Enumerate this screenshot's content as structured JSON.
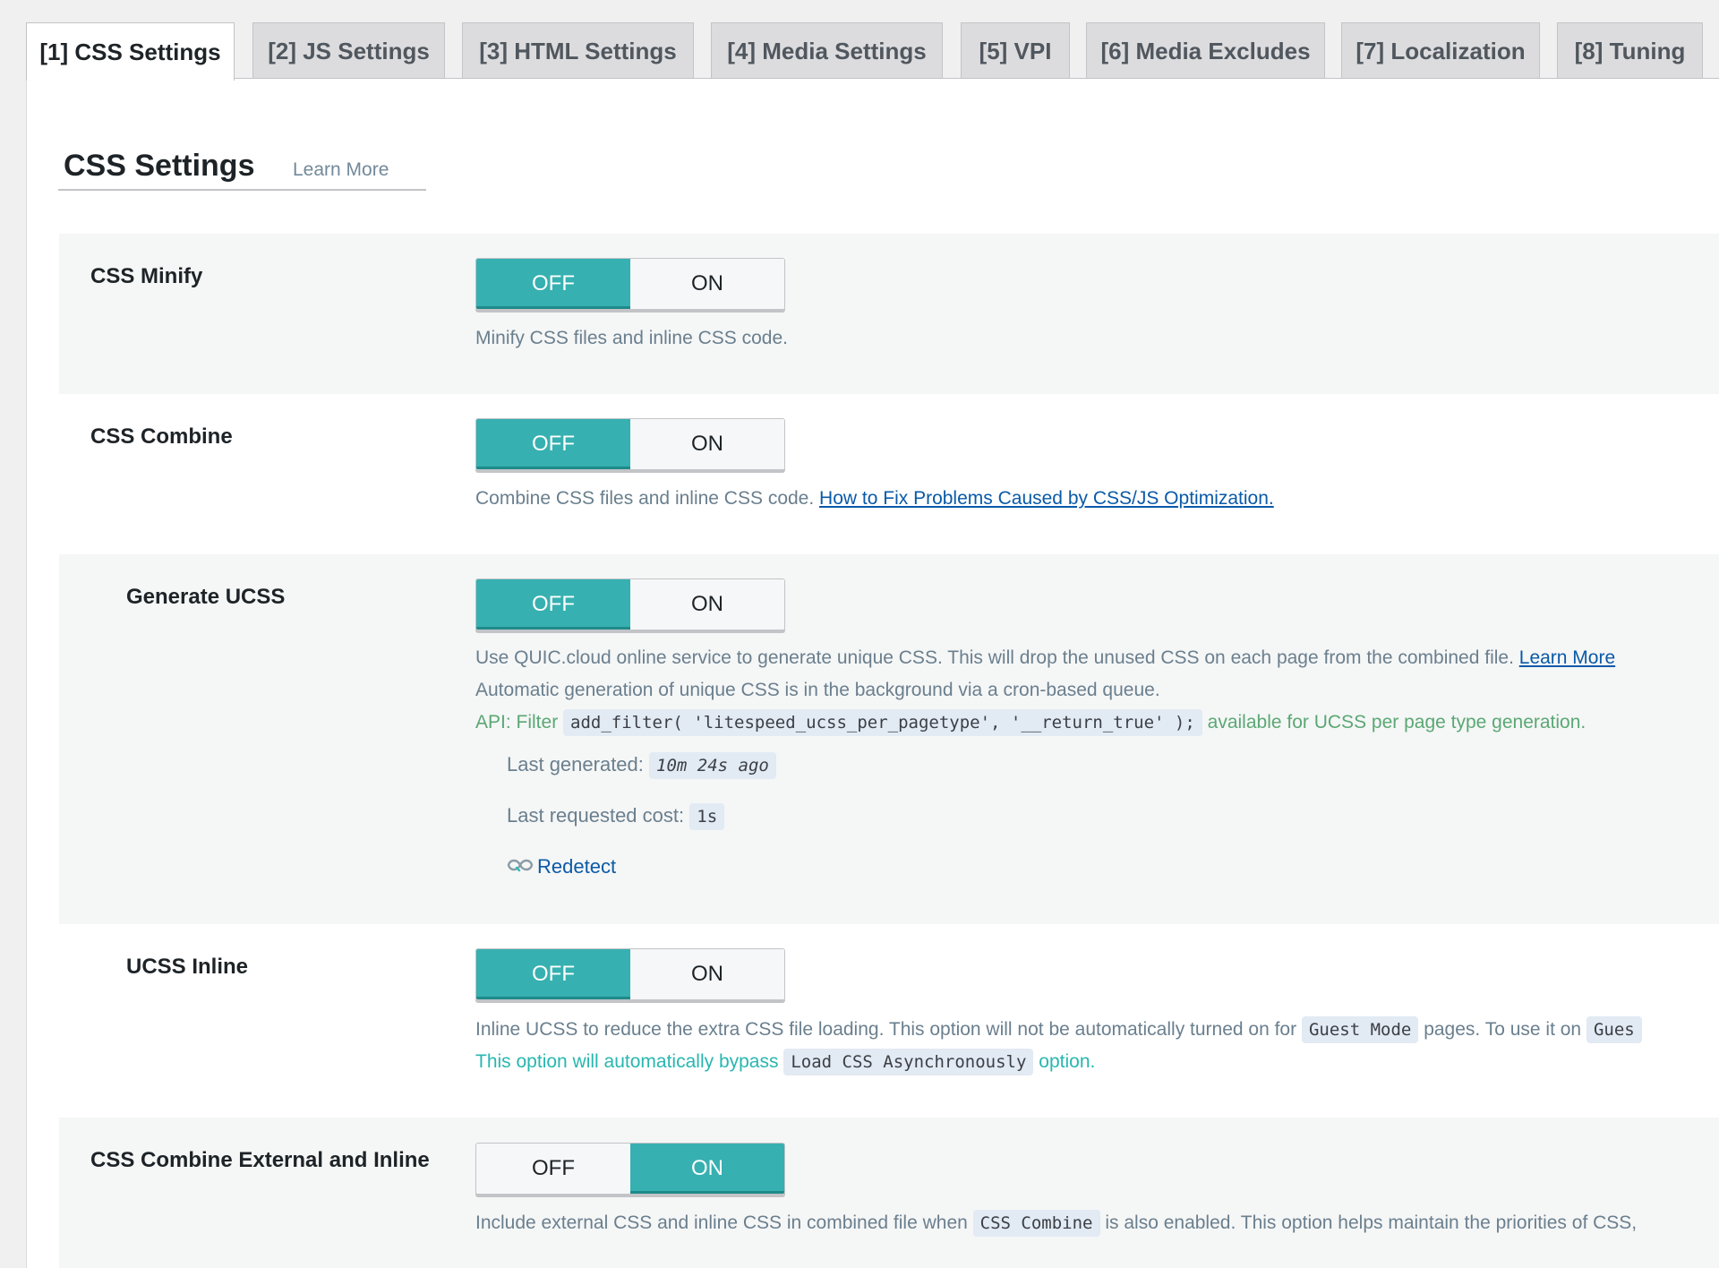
{
  "tabs": [
    {
      "label": "[1] CSS Settings",
      "active": true
    },
    {
      "label": "[2] JS Settings",
      "active": false
    },
    {
      "label": "[3] HTML Settings",
      "active": false
    },
    {
      "label": "[4] Media Settings",
      "active": false
    },
    {
      "label": "[5] VPI",
      "active": false
    },
    {
      "label": "[6] Media Excludes",
      "active": false
    },
    {
      "label": "[7] Localization",
      "active": false
    },
    {
      "label": "[8] Tuning",
      "active": false
    }
  ],
  "section": {
    "title": "CSS Settings",
    "learn_more": "Learn More"
  },
  "toggle_labels": {
    "off": "OFF",
    "on": "ON"
  },
  "settings": {
    "css_minify": {
      "label": "CSS Minify",
      "value": "OFF",
      "description": "Minify CSS files and inline CSS code."
    },
    "css_combine": {
      "label": "CSS Combine",
      "value": "OFF",
      "description": "Combine CSS files and inline CSS code.",
      "link": "How to Fix Problems Caused by CSS/JS Optimization."
    },
    "generate_ucss": {
      "label": "Generate UCSS",
      "value": "OFF",
      "description_1": "Use QUIC.cloud online service to generate unique CSS. This will drop the unused CSS on each page from the combined file.",
      "learn_more": "Learn More",
      "description_2": "Automatic generation of unique CSS is in the background via a cron-based queue.",
      "api_prefix": "API: Filter",
      "api_code": "add_filter( 'litespeed_ucss_per_pagetype', '__return_true' );",
      "api_suffix": "available for UCSS per page type generation.",
      "last_generated_label": "Last generated:",
      "last_generated_value": "10m 24s ago",
      "last_cost_label": "Last requested cost:",
      "last_cost_value": "1s",
      "redetect": "Redetect"
    },
    "ucss_inline": {
      "label": "UCSS Inline",
      "value": "OFF",
      "description_1": "Inline UCSS to reduce the extra CSS file loading. This option will not be automatically turned on for",
      "code_1": "Guest Mode",
      "description_1b": "pages. To use it on",
      "code_1b": "Gues",
      "description_2": "This option will automatically bypass",
      "code_2": "Load CSS Asynchronously",
      "description_2b": "option."
    },
    "css_combine_ext_inline": {
      "label": "CSS Combine External and Inline",
      "value": "ON",
      "description_1": "Include external CSS and inline CSS in combined file when",
      "code": "CSS Combine",
      "description_2": "is also enabled. This option helps maintain the priorities of CSS,"
    }
  },
  "colors": {
    "toggle_active": "#36b0b0",
    "link": "#0a5aa8",
    "api_green": "#5aa874",
    "note_teal": "#28b7b0",
    "muted_text": "#6a7f8e"
  }
}
